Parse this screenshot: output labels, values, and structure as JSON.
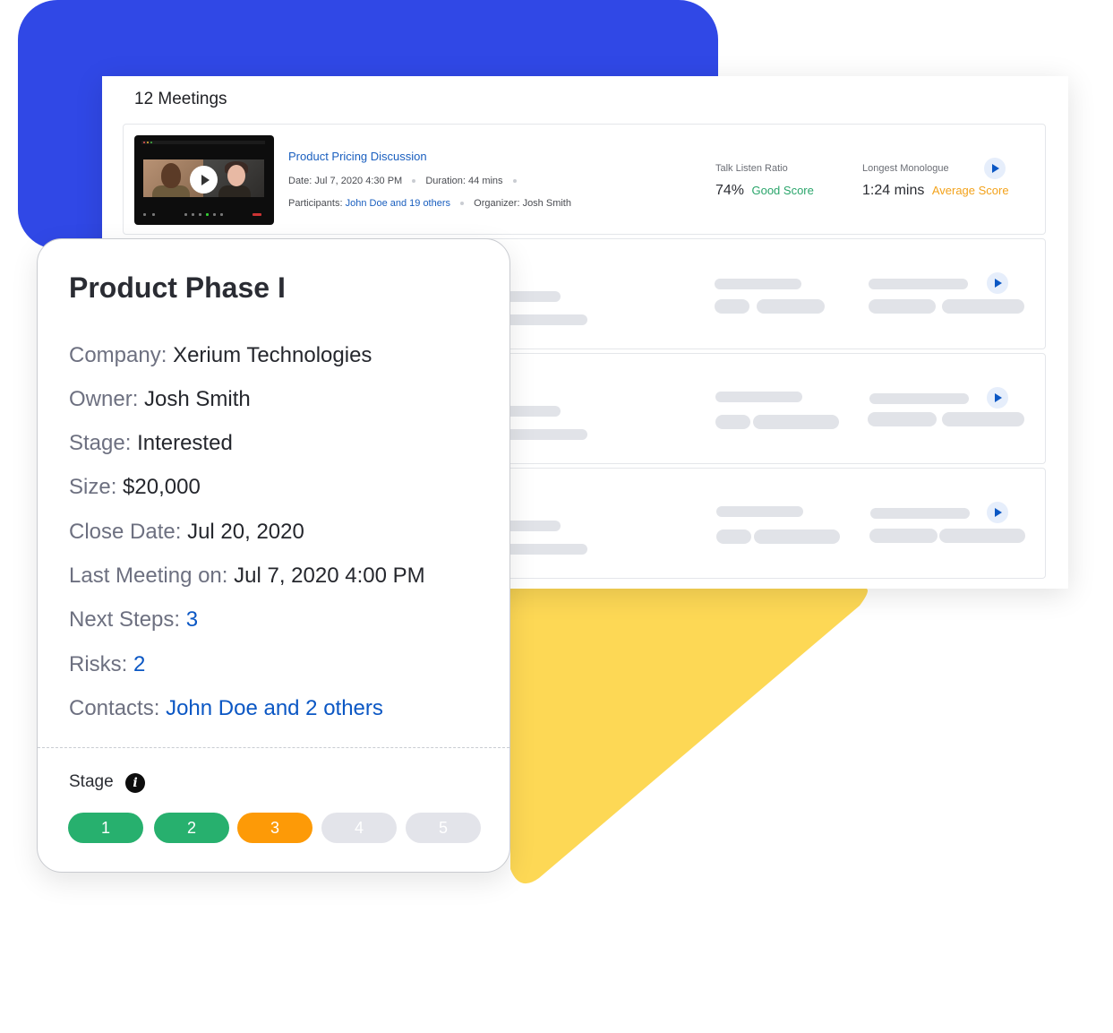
{
  "colors": {
    "brand_blue": "#3048e6",
    "yellow": "#fdd855",
    "link": "#1a5fbf",
    "good": "#2aa56b",
    "average": "#f3a21b",
    "stage_done": "#27b06e",
    "stage_current": "#fd9a07",
    "stage_pending": "#e3e4ea"
  },
  "meetings": {
    "title": "12 Meetings",
    "featured": {
      "title": "Product Pricing Discussion",
      "date_label": "Date:",
      "date_value": "Jul 7, 2020 4:30 PM",
      "duration_label": "Duration:",
      "duration_value": "44 mins",
      "participants_label": "Participants:",
      "participants_value": "John Doe and 19 others",
      "organizer_label": "Organizer:",
      "organizer_value": "Josh Smith",
      "talk_listen": {
        "label": "Talk Listen Ratio",
        "value": "74%",
        "score": "Good Score"
      },
      "longest_monologue": {
        "label": "Longest Monologue",
        "value": "1:24 mins",
        "score": "Average Score"
      },
      "play_icon": "play-icon",
      "thumbnail_icon": "video-thumbnail"
    },
    "placeholder_rows": 3
  },
  "deal": {
    "title": "Product Phase I",
    "fields": [
      {
        "label": "Company:",
        "value": "Xerium Technologies",
        "link": false
      },
      {
        "label": "Owner:",
        "value": "Josh Smith",
        "link": false
      },
      {
        "label": "Stage:",
        "value": "Interested",
        "link": false
      },
      {
        "label": "Size:",
        "value": "$20,000",
        "link": false
      },
      {
        "label": "Close Date:",
        "value": "Jul 20, 2020",
        "link": false
      },
      {
        "label": "Last Meeting on:",
        "value": "Jul 7, 2020 4:00 PM",
        "link": false
      },
      {
        "label": "Next Steps:",
        "value": "3",
        "link": true
      },
      {
        "label": "Risks:",
        "value": "2",
        "link": true
      },
      {
        "label": "Contacts:",
        "value": "John Doe and 2 others",
        "link": true
      }
    ],
    "stage_section": {
      "label": "Stage",
      "info_icon": "i",
      "current_stage": 3,
      "total_stages": 5,
      "stages": [
        {
          "label": "1",
          "status": "done"
        },
        {
          "label": "2",
          "status": "done"
        },
        {
          "label": "3",
          "status": "current"
        },
        {
          "label": "4",
          "status": "pending"
        },
        {
          "label": "5",
          "status": "pending"
        }
      ]
    }
  }
}
